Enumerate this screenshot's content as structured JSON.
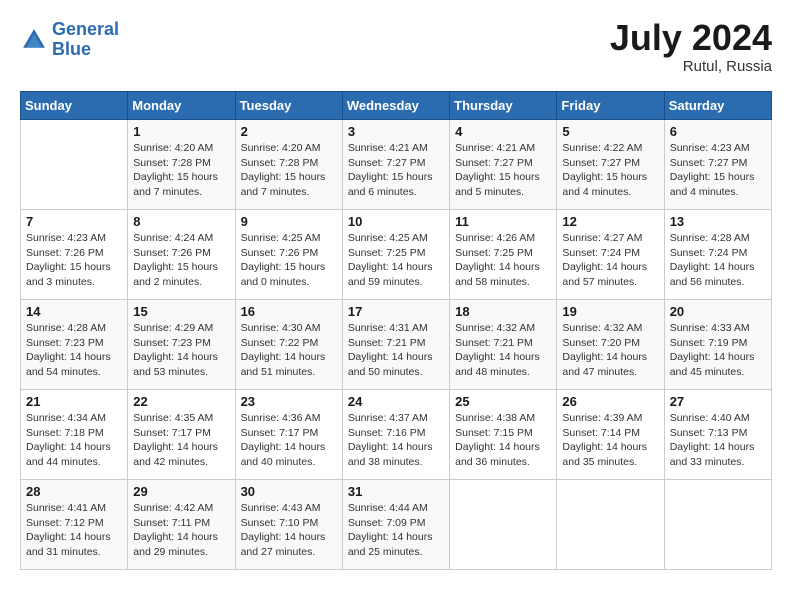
{
  "header": {
    "logo_line1": "General",
    "logo_line2": "Blue",
    "month_year": "July 2024",
    "location": "Rutul, Russia"
  },
  "weekdays": [
    "Sunday",
    "Monday",
    "Tuesday",
    "Wednesday",
    "Thursday",
    "Friday",
    "Saturday"
  ],
  "weeks": [
    [
      {
        "day": "",
        "info": ""
      },
      {
        "day": "1",
        "info": "Sunrise: 4:20 AM\nSunset: 7:28 PM\nDaylight: 15 hours\nand 7 minutes."
      },
      {
        "day": "2",
        "info": "Sunrise: 4:20 AM\nSunset: 7:28 PM\nDaylight: 15 hours\nand 7 minutes."
      },
      {
        "day": "3",
        "info": "Sunrise: 4:21 AM\nSunset: 7:27 PM\nDaylight: 15 hours\nand 6 minutes."
      },
      {
        "day": "4",
        "info": "Sunrise: 4:21 AM\nSunset: 7:27 PM\nDaylight: 15 hours\nand 5 minutes."
      },
      {
        "day": "5",
        "info": "Sunrise: 4:22 AM\nSunset: 7:27 PM\nDaylight: 15 hours\nand 4 minutes."
      },
      {
        "day": "6",
        "info": "Sunrise: 4:23 AM\nSunset: 7:27 PM\nDaylight: 15 hours\nand 4 minutes."
      }
    ],
    [
      {
        "day": "7",
        "info": "Sunrise: 4:23 AM\nSunset: 7:26 PM\nDaylight: 15 hours\nand 3 minutes."
      },
      {
        "day": "8",
        "info": "Sunrise: 4:24 AM\nSunset: 7:26 PM\nDaylight: 15 hours\nand 2 minutes."
      },
      {
        "day": "9",
        "info": "Sunrise: 4:25 AM\nSunset: 7:26 PM\nDaylight: 15 hours\nand 0 minutes."
      },
      {
        "day": "10",
        "info": "Sunrise: 4:25 AM\nSunset: 7:25 PM\nDaylight: 14 hours\nand 59 minutes."
      },
      {
        "day": "11",
        "info": "Sunrise: 4:26 AM\nSunset: 7:25 PM\nDaylight: 14 hours\nand 58 minutes."
      },
      {
        "day": "12",
        "info": "Sunrise: 4:27 AM\nSunset: 7:24 PM\nDaylight: 14 hours\nand 57 minutes."
      },
      {
        "day": "13",
        "info": "Sunrise: 4:28 AM\nSunset: 7:24 PM\nDaylight: 14 hours\nand 56 minutes."
      }
    ],
    [
      {
        "day": "14",
        "info": "Sunrise: 4:28 AM\nSunset: 7:23 PM\nDaylight: 14 hours\nand 54 minutes."
      },
      {
        "day": "15",
        "info": "Sunrise: 4:29 AM\nSunset: 7:23 PM\nDaylight: 14 hours\nand 53 minutes."
      },
      {
        "day": "16",
        "info": "Sunrise: 4:30 AM\nSunset: 7:22 PM\nDaylight: 14 hours\nand 51 minutes."
      },
      {
        "day": "17",
        "info": "Sunrise: 4:31 AM\nSunset: 7:21 PM\nDaylight: 14 hours\nand 50 minutes."
      },
      {
        "day": "18",
        "info": "Sunrise: 4:32 AM\nSunset: 7:21 PM\nDaylight: 14 hours\nand 48 minutes."
      },
      {
        "day": "19",
        "info": "Sunrise: 4:32 AM\nSunset: 7:20 PM\nDaylight: 14 hours\nand 47 minutes."
      },
      {
        "day": "20",
        "info": "Sunrise: 4:33 AM\nSunset: 7:19 PM\nDaylight: 14 hours\nand 45 minutes."
      }
    ],
    [
      {
        "day": "21",
        "info": "Sunrise: 4:34 AM\nSunset: 7:18 PM\nDaylight: 14 hours\nand 44 minutes."
      },
      {
        "day": "22",
        "info": "Sunrise: 4:35 AM\nSunset: 7:17 PM\nDaylight: 14 hours\nand 42 minutes."
      },
      {
        "day": "23",
        "info": "Sunrise: 4:36 AM\nSunset: 7:17 PM\nDaylight: 14 hours\nand 40 minutes."
      },
      {
        "day": "24",
        "info": "Sunrise: 4:37 AM\nSunset: 7:16 PM\nDaylight: 14 hours\nand 38 minutes."
      },
      {
        "day": "25",
        "info": "Sunrise: 4:38 AM\nSunset: 7:15 PM\nDaylight: 14 hours\nand 36 minutes."
      },
      {
        "day": "26",
        "info": "Sunrise: 4:39 AM\nSunset: 7:14 PM\nDaylight: 14 hours\nand 35 minutes."
      },
      {
        "day": "27",
        "info": "Sunrise: 4:40 AM\nSunset: 7:13 PM\nDaylight: 14 hours\nand 33 minutes."
      }
    ],
    [
      {
        "day": "28",
        "info": "Sunrise: 4:41 AM\nSunset: 7:12 PM\nDaylight: 14 hours\nand 31 minutes."
      },
      {
        "day": "29",
        "info": "Sunrise: 4:42 AM\nSunset: 7:11 PM\nDaylight: 14 hours\nand 29 minutes."
      },
      {
        "day": "30",
        "info": "Sunrise: 4:43 AM\nSunset: 7:10 PM\nDaylight: 14 hours\nand 27 minutes."
      },
      {
        "day": "31",
        "info": "Sunrise: 4:44 AM\nSunset: 7:09 PM\nDaylight: 14 hours\nand 25 minutes."
      },
      {
        "day": "",
        "info": ""
      },
      {
        "day": "",
        "info": ""
      },
      {
        "day": "",
        "info": ""
      }
    ]
  ]
}
